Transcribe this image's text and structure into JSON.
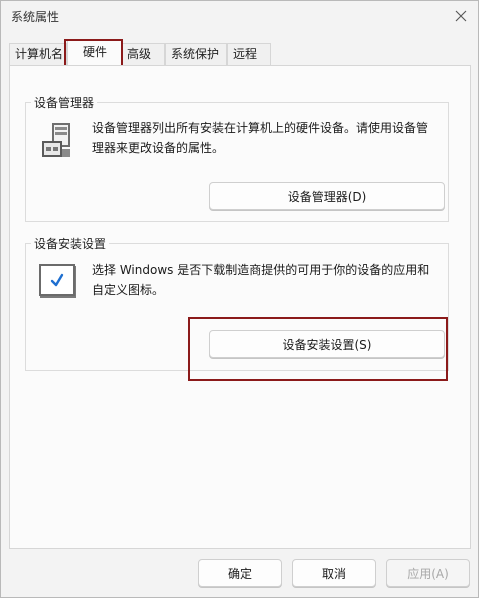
{
  "window": {
    "title": "系统属性"
  },
  "tabs": [
    {
      "label": "计算机名"
    },
    {
      "label": "硬件"
    },
    {
      "label": "高级"
    },
    {
      "label": "系统保护"
    },
    {
      "label": "远程"
    }
  ],
  "device_manager": {
    "group_label": "设备管理器",
    "description": "设备管理器列出所有安装在计算机上的硬件设备。请使用设备管理器来更改设备的属性。",
    "button_label": "设备管理器(D)"
  },
  "device_install": {
    "group_label": "设备安装设置",
    "description": "选择 Windows 是否下载制造商提供的可用于你的设备的应用和自定义图标。",
    "button_label": "设备安装设置(S)"
  },
  "footer": {
    "ok_label": "确定",
    "cancel_label": "取消",
    "apply_label": "应用(A)"
  },
  "colors": {
    "highlight": "#8b1a1a",
    "check_blue": "#1e6fd0"
  }
}
